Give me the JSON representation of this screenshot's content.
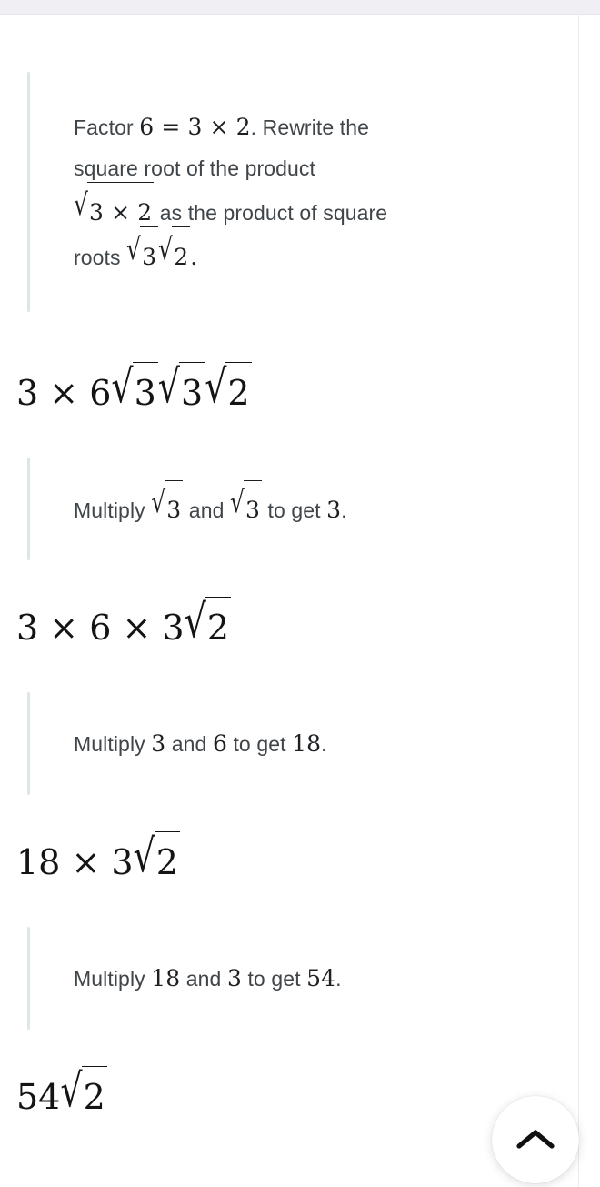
{
  "page": {
    "title": "Step-by-step solution",
    "accent_bar_color": "#dce7e7",
    "math_text_color": "#141414",
    "prose_text_color": "#3f4549",
    "top_strip_color": "#f0f0f4"
  },
  "steps": [
    {
      "type": "hint",
      "name": "step-1-explanation",
      "segments": [
        {
          "kind": "text",
          "value": "Factor "
        },
        {
          "kind": "math",
          "value": "6 = 3 × 2"
        },
        {
          "kind": "text",
          "value": ". Rewrite the square root of the product "
        },
        {
          "kind": "math",
          "value": "√(3 × 2)"
        },
        {
          "kind": "text",
          "value": " as the product of square roots "
        },
        {
          "kind": "math",
          "value": "√3√2"
        },
        {
          "kind": "text",
          "value": "."
        }
      ],
      "plain": "Factor 6 = 3 × 2. Rewrite the square root of the product √(3 × 2) as the product of square roots √3√2."
    },
    {
      "type": "result",
      "name": "step-1-result",
      "expression": "3 × 6√3√3√2"
    },
    {
      "type": "hint",
      "name": "step-2-explanation",
      "plain": "Multiply √3 and √3 to get 3."
    },
    {
      "type": "result",
      "name": "step-2-result",
      "expression": "3 × 6 × 3√2"
    },
    {
      "type": "hint",
      "name": "step-3-explanation",
      "plain": "Multiply 3 and 6 to get 18."
    },
    {
      "type": "result",
      "name": "step-3-result",
      "expression": "18 × 3√2"
    },
    {
      "type": "hint",
      "name": "step-4-explanation",
      "plain": "Multiply 18 and 3 to get 54."
    },
    {
      "type": "result",
      "name": "step-4-result",
      "expression": "54√2"
    }
  ],
  "step1": {
    "t1": "Factor ",
    "m1_a": "6",
    "m1_eq": "=",
    "m1_b": "3",
    "m1_times": "×",
    "m1_c": "2",
    "t2": ". Rewrite the",
    "t3": "square root of the product",
    "m2_a": "3",
    "m2_times": "×",
    "m2_b": "2",
    "t4": " as the product of square",
    "t5": "roots ",
    "m3_a": "3",
    "m3_b": "2",
    "t6": "."
  },
  "step1_result": {
    "a": "3",
    "times1": "×",
    "b": "6",
    "r1": "3",
    "r2": "3",
    "r3": "2"
  },
  "step2": {
    "t1": "Multiply ",
    "r1": "3",
    "t2": " and ",
    "r2": "3",
    "t3": " to get ",
    "n": "3",
    "t4": "."
  },
  "step2_result": {
    "a": "3",
    "times1": "×",
    "b": "6",
    "times2": "×",
    "c": "3",
    "r1": "2"
  },
  "step3": {
    "t1": "Multiply ",
    "n1": "3",
    "t2": " and ",
    "n2": "6",
    "t3": " to get ",
    "n3": "18",
    "t4": "."
  },
  "step3_result": {
    "a": "18",
    "times1": "×",
    "b": "3",
    "r1": "2"
  },
  "step4": {
    "t1": "Multiply ",
    "n1": "18",
    "t2": " and ",
    "n2": "3",
    "t3": " to get ",
    "n3": "54",
    "t4": "."
  },
  "step4_result": {
    "a": "54",
    "r1": "2"
  },
  "fab": {
    "label": "Scroll to top",
    "icon": "chevron-up-icon"
  },
  "radical_sign": "√"
}
